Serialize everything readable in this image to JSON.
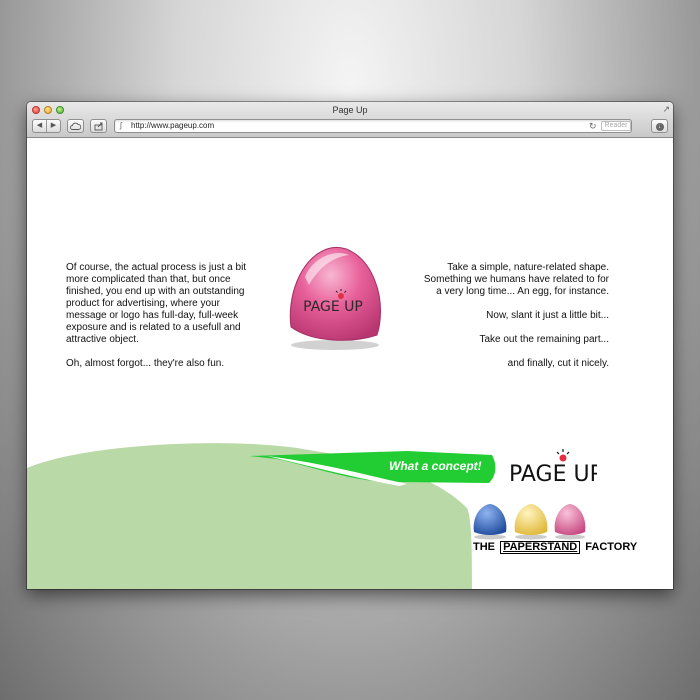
{
  "window": {
    "title": "Page Up",
    "url": "http://www.pageup.com",
    "reader_label": "Reader"
  },
  "icons": {
    "back": "back-arrow-icon",
    "forward": "forward-arrow-icon",
    "cloud": "cloud-icon",
    "share": "share-icon",
    "reload": "reload-icon",
    "download": "download-icon",
    "site": "site-icon",
    "resize": "fullscreen-icon"
  },
  "left_column": {
    "paragraph_1": "Of course, the actual process is just a bit more complicated than that, but once finished, you end up with an outstanding product for advertising, where your message or logo has full-day, full-week exposure and is related to a usefull and attractive object.",
    "paragraph_2": "Oh, almost forgot... they're also fun."
  },
  "right_column": {
    "paragraph_1": "Take a simple, nature-related shape. Something we humans have related to for a very long time... An egg, for instance.",
    "paragraph_2": "Now, slant it just a little bit...",
    "paragraph_3": "Take out the remaining part...",
    "paragraph_4": "and finally, cut it nicely."
  },
  "logo": {
    "text": "PAGE UP"
  },
  "footer": {
    "concept_text": "What a concept!",
    "brand_text": "PAGE UP",
    "factory_prefix": "THE",
    "factory_boxed": "PAPERSTAND",
    "factory_suffix": "FACTORY",
    "egg_colors": [
      "#2f5fb3",
      "#f2d060",
      "#e36a9a"
    ]
  },
  "colors": {
    "accent_green": "#22cc33",
    "blob_green": "#b9d9a7",
    "egg_pink": "#e8609a"
  }
}
